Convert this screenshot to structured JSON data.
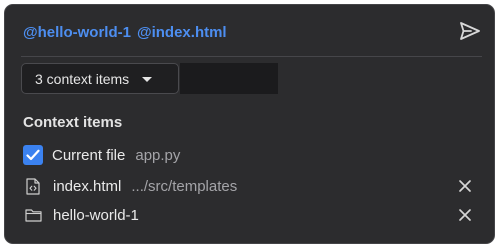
{
  "input": {
    "mentions": [
      "@hello-world-1",
      "@index.html"
    ]
  },
  "context_dropdown": {
    "label": "3 context items"
  },
  "context_section": {
    "title": "Context items",
    "current_file": {
      "label": "Current file",
      "filename": "app.py",
      "checked": true
    },
    "items": [
      {
        "name": "index.html",
        "path": ".../src/templates",
        "icon": "file-code-icon"
      },
      {
        "name": "hello-world-1",
        "path": "",
        "icon": "folder-icon"
      }
    ]
  },
  "colors": {
    "accent": "#4d8ef0",
    "panel_bg": "#2c2c2e",
    "checkbox": "#3b82f0"
  }
}
